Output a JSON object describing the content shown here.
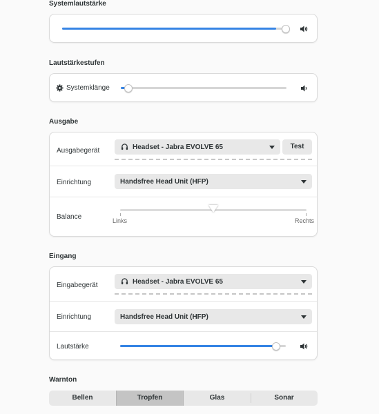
{
  "system_volume": {
    "title": "Systemlautstärke",
    "level": 0.92
  },
  "volume_levels": {
    "title": "Lautstärkestufen",
    "system_sounds_label": "Systemklänge",
    "level": 0.03
  },
  "output": {
    "title": "Ausgabe",
    "device_label": "Ausgabegerät",
    "device_value": "Headset - Jabra EVOLVE 65",
    "test_button": "Test",
    "config_label": "Einrichtung",
    "config_value": "Handsfree Head Unit (HFP)",
    "balance_label": "Balance",
    "balance_left": "Links",
    "balance_right": "Rechts",
    "balance_level": 0.5
  },
  "input": {
    "title": "Eingang",
    "device_label": "Eingabegerät",
    "device_value": "Headset - Jabra EVOLVE 65",
    "config_label": "Einrichtung",
    "config_value": "Handsfree Head Unit (HFP)",
    "volume_label": "Lautstärke",
    "volume_level": 0.94
  },
  "alert_sound": {
    "title": "Warnton",
    "options": [
      "Bellen",
      "Tropfen",
      "Glas",
      "Sonar"
    ],
    "selected": "Tropfen"
  },
  "colors": {
    "accent": "#3584e4",
    "background": "#fafafa",
    "card": "#ffffff"
  },
  "icons": [
    "speaker-icon",
    "gear-icon",
    "headset-icon",
    "dropdown-arrow-icon"
  ]
}
